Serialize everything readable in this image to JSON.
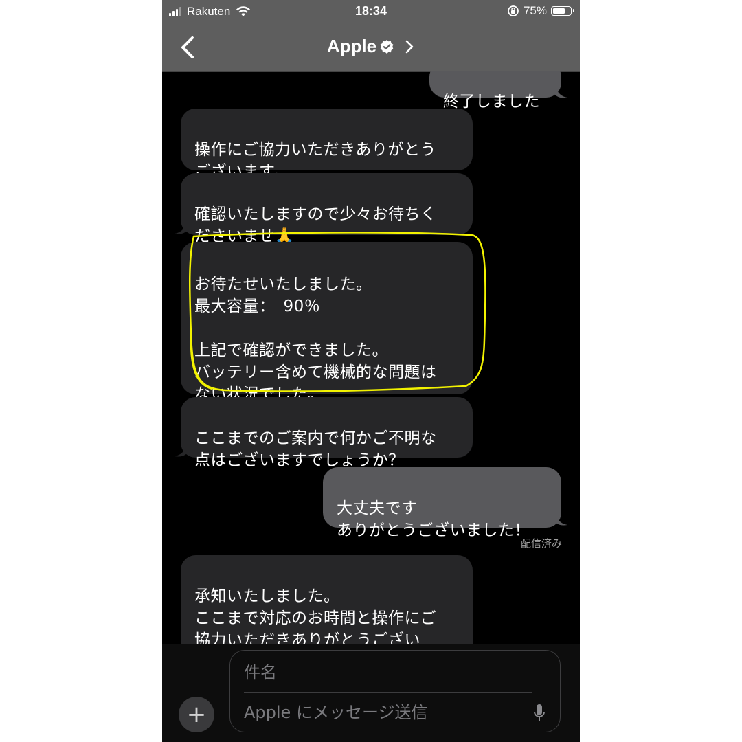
{
  "status": {
    "carrier": "Rakuten",
    "time": "18:34",
    "battery": "75%",
    "battery_level": 0.75
  },
  "header": {
    "title": "Apple"
  },
  "messages": [
    {
      "direction": "out",
      "text": "終了しました"
    },
    {
      "direction": "in",
      "text": "操作にご協力いただきありがとう\nございます。"
    },
    {
      "direction": "in",
      "text": "確認いたしますので少々お待ちく\nださいませ🙏"
    },
    {
      "direction": "in",
      "text": "お待たせいたしました。\n最大容量：　90％\n\n上記で確認ができました。\nバッテリー含めて機械的な問題は\nない状況でした。"
    },
    {
      "direction": "in",
      "text": "ここまでのご案内で何かご不明な\n点はございますでしょうか？"
    },
    {
      "direction": "out",
      "text": "大丈夫です\nありがとうございました！"
    },
    {
      "direction": "in",
      "text": "承知いたしました。\nここまで対応のお時間と操作にご\n協力いただきありがとうござい\nました！"
    }
  ],
  "delivered_label": "配信済み",
  "compose": {
    "subject_placeholder": "件名",
    "message_placeholder": "Apple にメッセージ送信",
    "add_label": "+"
  },
  "colors": {
    "incoming_bubble": "#262628",
    "outgoing_bubble": "#59595c",
    "highlight": "#f2f200",
    "header_bg": "#5e5e5e"
  }
}
